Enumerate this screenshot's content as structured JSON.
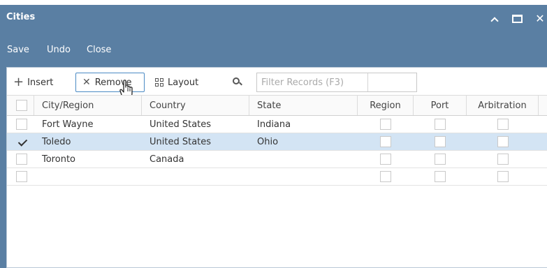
{
  "window": {
    "title": "Cities"
  },
  "menubar": {
    "save": "Save",
    "undo": "Undo",
    "close": "Close"
  },
  "toolbar": {
    "insert": "Insert",
    "remove": "Remove",
    "layout": "Layout",
    "filter_placeholder": "Filter Records (F3)"
  },
  "grid": {
    "columns": [
      "City/Region",
      "Country",
      "State",
      "Region",
      "Port",
      "Arbitration"
    ],
    "rows": [
      {
        "city": "Fort Wayne",
        "country": "United States",
        "state": "Indiana",
        "selected": false
      },
      {
        "city": "Toledo",
        "country": "United States",
        "state": "Ohio",
        "selected": true
      },
      {
        "city": "Toronto",
        "country": "Canada",
        "state": "",
        "selected": false
      },
      {
        "city": "",
        "country": "",
        "state": "",
        "selected": false
      }
    ]
  },
  "colors": {
    "titlebar": "#5a7fa3",
    "selected_row": "#d3e4f4",
    "active_button_border": "#4a8ac4"
  },
  "icons": {
    "minimize": "chevron-up-icon",
    "maximize": "maximize-icon",
    "close": "close-icon",
    "insert": "plus-icon",
    "remove": "x-icon",
    "layout": "grid-icon",
    "search": "search-icon",
    "cursor": "hand-pointer-icon"
  }
}
